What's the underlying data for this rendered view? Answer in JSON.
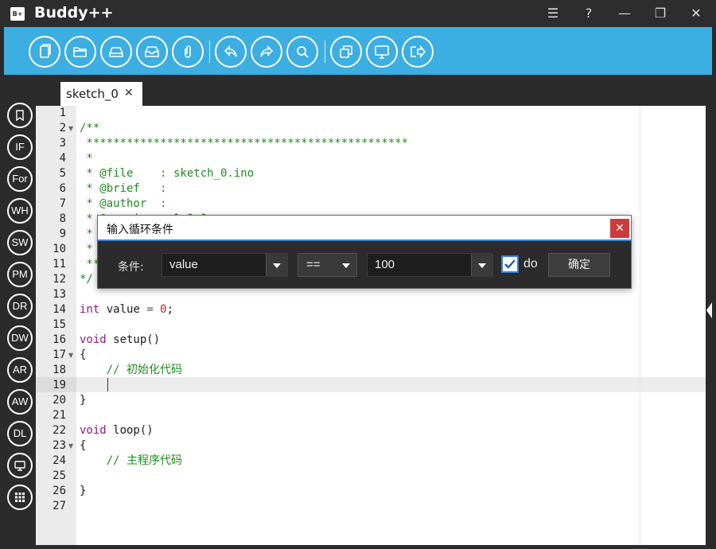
{
  "app": {
    "logo": "B+",
    "title": "Buddy++"
  },
  "window_controls": {
    "menu": "☰",
    "help": "?",
    "minimize": "—",
    "restore": "❐",
    "close": "✕"
  },
  "toolbar": {
    "buttons": [
      "new-file-icon",
      "open-folder-icon",
      "save-icon",
      "save-as-icon",
      "attach-icon",
      "undo-icon",
      "redo-icon",
      "search-icon",
      "copy-icon",
      "monitor-icon",
      "upload-icon"
    ]
  },
  "sidebar": {
    "items": [
      {
        "id": "bookmark",
        "label": ""
      },
      {
        "id": "if",
        "label": "IF"
      },
      {
        "id": "for",
        "label": "For"
      },
      {
        "id": "while",
        "label": "WH"
      },
      {
        "id": "switch",
        "label": "SW"
      },
      {
        "id": "pinmode",
        "label": "PM"
      },
      {
        "id": "digitalread",
        "label": "DR"
      },
      {
        "id": "digitalwrite",
        "label": "DW"
      },
      {
        "id": "analogread",
        "label": "AR"
      },
      {
        "id": "analogwrite",
        "label": "AW"
      },
      {
        "id": "delay",
        "label": "DL"
      },
      {
        "id": "monitor",
        "label": ""
      },
      {
        "id": "grid",
        "label": ""
      }
    ]
  },
  "tabs": [
    {
      "label": "sketch_0",
      "close": "✕"
    }
  ],
  "editor": {
    "active_line": 19,
    "lines": [
      {
        "n": "1",
        "text": ""
      },
      {
        "n": "2",
        "text": "/**",
        "fold": true
      },
      {
        "n": "3",
        "text": " ************************************************"
      },
      {
        "n": "4",
        "text": " *"
      },
      {
        "n": "5",
        "text": " * @file    : sketch_0.ino"
      },
      {
        "n": "6",
        "text": " * @brief   :"
      },
      {
        "n": "7",
        "text": " * @author  :"
      },
      {
        "n": "8",
        "text": " * @version : 1.0.0"
      },
      {
        "n": "9",
        "text": " *"
      },
      {
        "n": "10",
        "text": " *"
      },
      {
        "n": "11",
        "text": " **"
      },
      {
        "n": "12",
        "text": "*/"
      },
      {
        "n": "13",
        "text": ""
      },
      {
        "n": "14",
        "text": "int value = 0;"
      },
      {
        "n": "15",
        "text": ""
      },
      {
        "n": "16",
        "text": "void setup()"
      },
      {
        "n": "17",
        "text": "{",
        "fold": true
      },
      {
        "n": "18",
        "text": "    // 初始化代码"
      },
      {
        "n": "19",
        "text": ""
      },
      {
        "n": "20",
        "text": "}"
      },
      {
        "n": "21",
        "text": ""
      },
      {
        "n": "22",
        "text": "void loop()"
      },
      {
        "n": "23",
        "text": "{",
        "fold": true
      },
      {
        "n": "24",
        "text": "    // 主程序代码"
      },
      {
        "n": "25",
        "text": ""
      },
      {
        "n": "26",
        "text": "}"
      },
      {
        "n": "27",
        "text": ""
      }
    ],
    "code": {
      "kw_int": "int",
      "var_value": " value ",
      "op_eq": "=",
      "num_0": " 0",
      "semi": ";",
      "kw_void": "void",
      "fn_setup": " setup()",
      "fn_loop": " loop()",
      "comment_setup": "    // 初始化代码",
      "comment_loop": "    // 主程序代码"
    }
  },
  "dialog": {
    "title": "输入循环条件",
    "close": "✕",
    "condition_label": "条件:",
    "variable": "value",
    "operator": "==",
    "compare_value": "100",
    "do_checked": true,
    "do_label": "do",
    "ok_label": "确定"
  }
}
